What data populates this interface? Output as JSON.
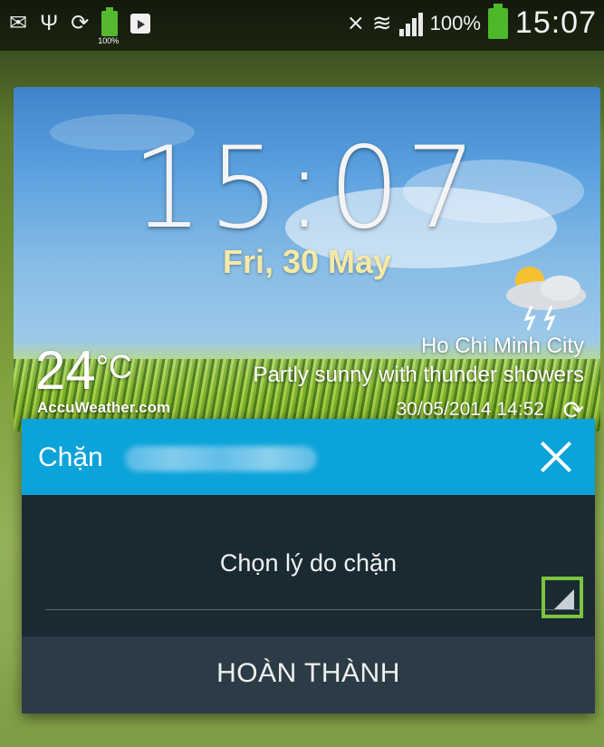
{
  "status_bar": {
    "left_icons": [
      "mail-icon",
      "usb-icon",
      "sync-icon",
      "battery-100-icon",
      "play-store-icon"
    ],
    "battery_small_label": "100%",
    "battery_percent": "100%",
    "time": "15:07"
  },
  "weather_widget": {
    "time": "15:07",
    "date": "Fri, 30 May",
    "temperature": "24",
    "temperature_unit": "°C",
    "provider": "AccuWeather.com",
    "city": "Ho Chi Minh City",
    "condition": "Partly sunny with thunder showers",
    "updated": "30/05/2014 14:52"
  },
  "dialog": {
    "title": "Chặn",
    "reason_prompt": "Chọn lý do chặn",
    "done_button": "HOÀN THÀNH"
  }
}
